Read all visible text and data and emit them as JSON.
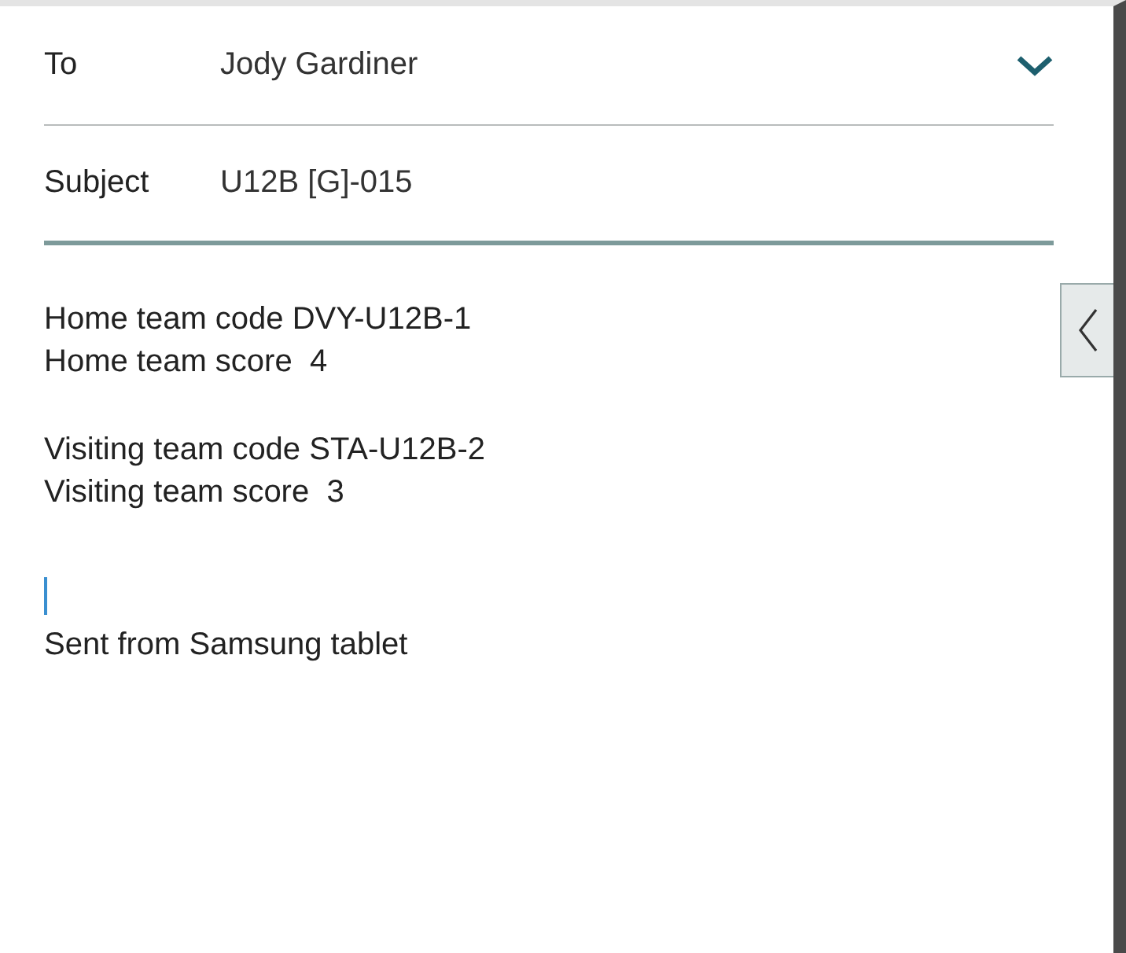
{
  "to": {
    "label": "To",
    "value": "Jody Gardiner"
  },
  "subject": {
    "label": "Subject",
    "value": "U12B [G]-015"
  },
  "body": {
    "paragraphs": [
      [
        "Home team code DVY-U12B-1",
        "Home team score  4"
      ],
      [
        "Visiting team code STA-U12B-2",
        "Visiting team score  3"
      ]
    ],
    "signature": "Sent from Samsung tablet"
  }
}
